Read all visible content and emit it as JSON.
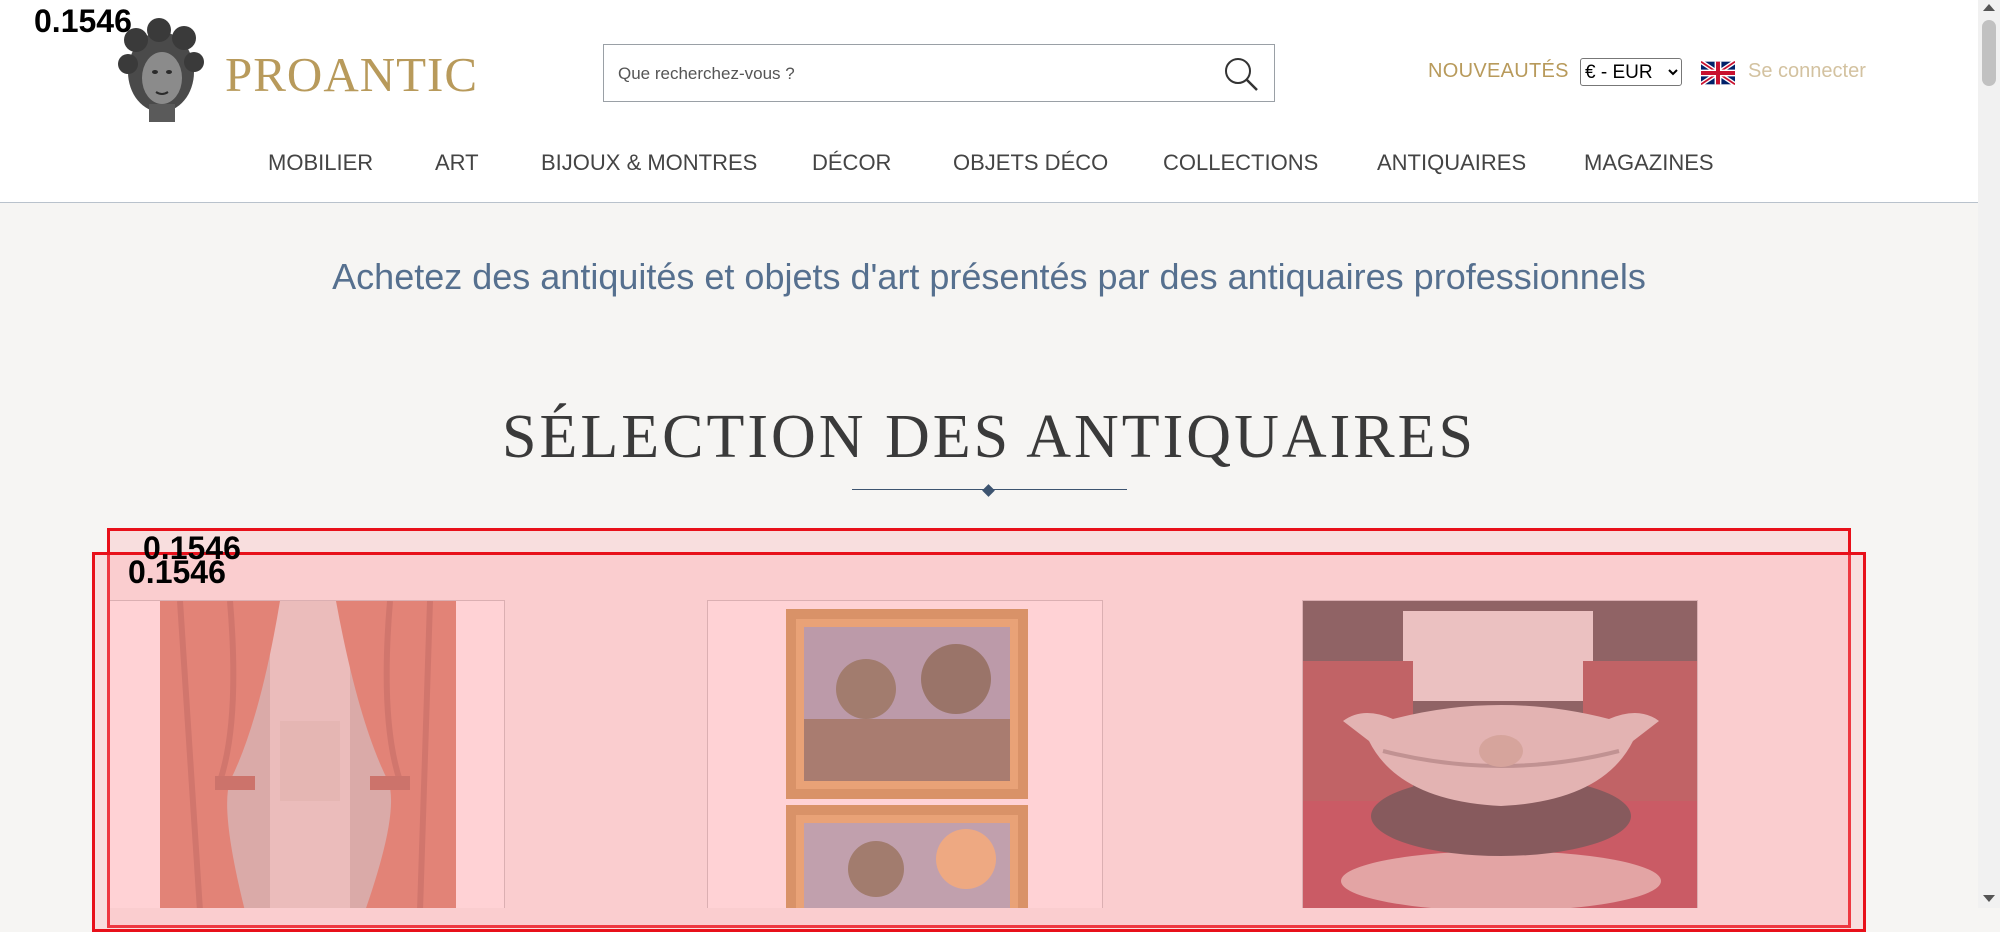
{
  "header": {
    "logo_text": "PROANTIC",
    "search": {
      "placeholder": "Que recherchez-vous ?",
      "value": ""
    },
    "new_link": "NOUVEAUTÉS",
    "currency": {
      "selected": "€ - EUR",
      "options": [
        "€ - EUR"
      ]
    },
    "language_flag": "uk-flag-icon",
    "login": "Se connecter"
  },
  "nav": {
    "items": [
      {
        "label": "MOBILIER"
      },
      {
        "label": "ART"
      },
      {
        "label": "BIJOUX & MONTRES"
      },
      {
        "label": "DÉCOR"
      },
      {
        "label": "OBJETS DÉCO"
      },
      {
        "label": "COLLECTIONS"
      },
      {
        "label": "ANTIQUAIRES"
      },
      {
        "label": "MAGAZINES"
      }
    ]
  },
  "main": {
    "tagline": "Achetez des antiquités et objets d'art présentés par des antiquaires professionnels",
    "section_title": "SÉLECTION DES ANTIQUAIRES",
    "products": [
      {
        "image": "curtains-photo"
      },
      {
        "image": "framed-landscape-paintings-photo"
      },
      {
        "image": "silver-jardiniere-photo"
      }
    ]
  },
  "overlay": {
    "labels": [
      "0.1546",
      "0.1546",
      "0.1546"
    ]
  },
  "colors": {
    "accent_gold": "#b89a5b",
    "tagline_blue": "#56708f",
    "overlay_red": "#e8101a",
    "page_bg": "#f6f5f3"
  }
}
